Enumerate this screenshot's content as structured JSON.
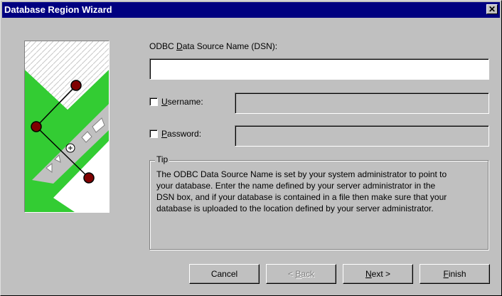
{
  "window": {
    "title": "Database Region Wizard",
    "close_glyph": "✕"
  },
  "dsn": {
    "label_pre": "ODBC ",
    "label_accel": "D",
    "label_post": "ata Source Name (DSN):",
    "value": ""
  },
  "username": {
    "accel": "U",
    "label_rest": "sername:",
    "checked": false,
    "value": ""
  },
  "password": {
    "accel": "P",
    "label_rest": "assword:",
    "checked": false,
    "value": ""
  },
  "tip": {
    "title": "Tip",
    "lines": [
      "The ODBC Data Source Name is set by your system administrator to point to",
      "your database.  Enter the name defined by your server administrator in the",
      "DSN box, and if your database is contained in a file then make sure that your",
      "database is uploaded to the location defined by your server administrator."
    ]
  },
  "buttons": {
    "cancel": "Cancel",
    "back_arrow": "< ",
    "back_accel": "B",
    "back_rest": "ack",
    "next_accel": "N",
    "next_rest": "ext >",
    "finish_accel": "F",
    "finish_rest": "inish"
  },
  "colors": {
    "titlebar": "#000080",
    "face": "#c0c0c0",
    "graphic_green": "#33cc33",
    "node": "#800000"
  }
}
